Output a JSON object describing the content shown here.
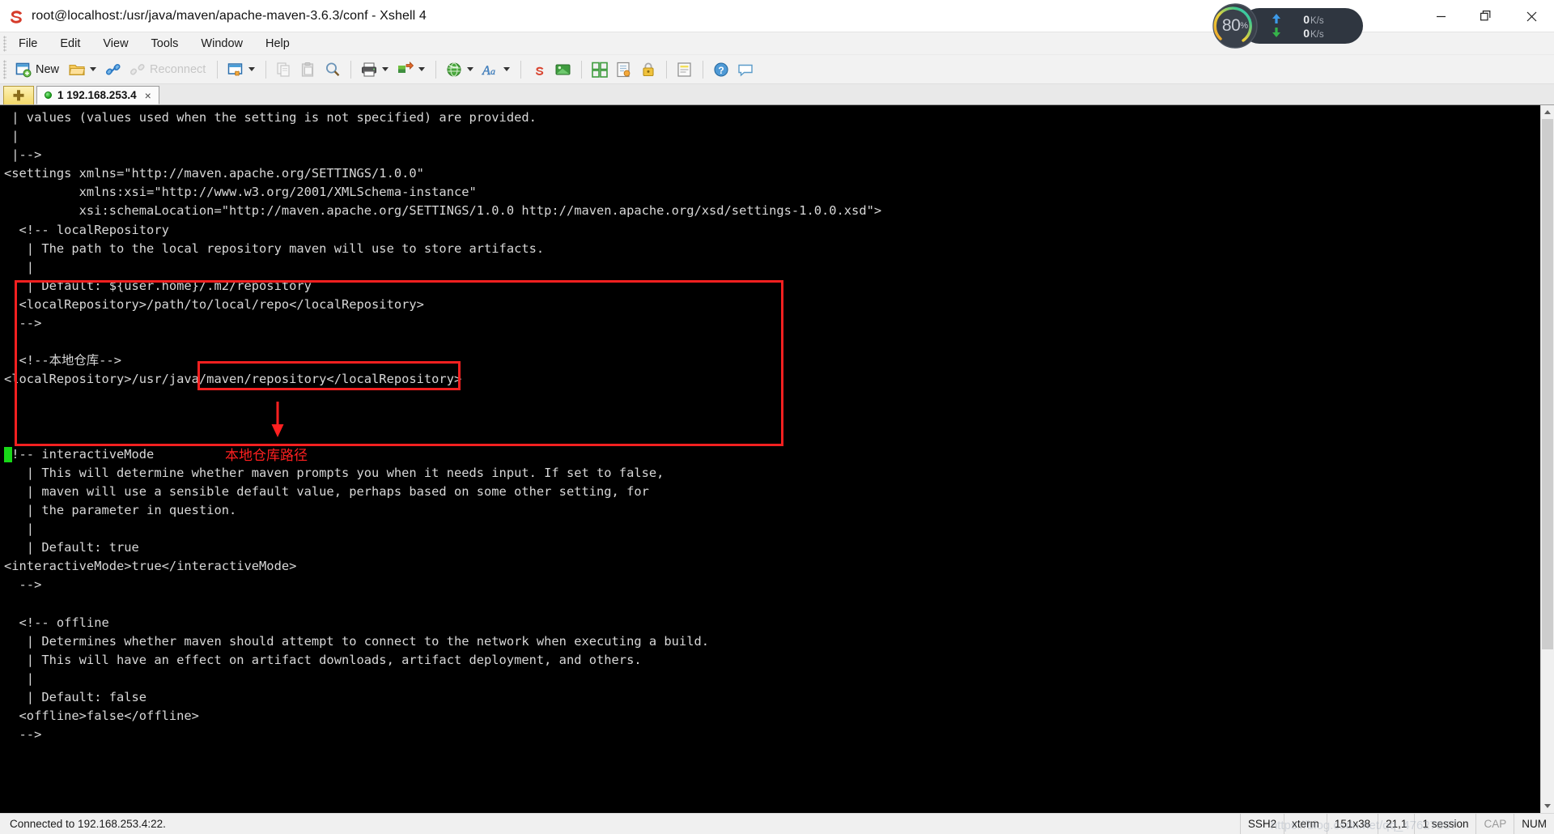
{
  "window": {
    "title": "root@localhost:/usr/java/maven/apache-maven-3.6.3/conf - Xshell 4",
    "app_icon": "xshell-icon",
    "minimize_label": "—",
    "maximize_label": "❐",
    "close_label": "✕"
  },
  "menu": {
    "items": [
      {
        "label": "File"
      },
      {
        "label": "Edit"
      },
      {
        "label": "View"
      },
      {
        "label": "Tools"
      },
      {
        "label": "Window"
      },
      {
        "label": "Help"
      }
    ]
  },
  "toolbar": {
    "new_label": "New",
    "new_icon": "new-session-icon",
    "open_icon": "open-folder-icon",
    "connect_icon": "connect-icon",
    "reconnect_label": "Reconnect",
    "reconnect_icon": "reconnect-icon",
    "properties_icon": "session-properties-icon",
    "copy_icon": "copy-icon",
    "paste_icon": "paste-icon",
    "find_icon": "find-icon",
    "print_icon": "print-icon",
    "transfer_icon": "file-transfer-icon",
    "web_icon": "web-browser-icon",
    "font_icon": "font-icon",
    "ztransfer_icon": "zmodem-transfer-icon",
    "xftp_icon": "xftp-icon",
    "compose_icon": "compose-bar-icon",
    "log_icon": "log-icon",
    "lock_icon": "lock-icon",
    "highlight_icon": "highlight-icon",
    "help_icon": "help-icon",
    "chat_icon": "chat-icon"
  },
  "tabs": {
    "new_tab_icon": "plus-icon",
    "new_tab_glyph": "✚",
    "items": [
      {
        "title": "1 192.168.253.4",
        "status_dot": "connected-dot",
        "close_glyph": "×"
      }
    ]
  },
  "terminal": {
    "cursor": {
      "line_index": 18,
      "color": "#18d818"
    },
    "lines": [
      " | values (values used when the setting is not specified) are provided.",
      " |",
      " |-->",
      "<settings xmlns=\"http://maven.apache.org/SETTINGS/1.0.0\"",
      "          xmlns:xsi=\"http://www.w3.org/2001/XMLSchema-instance\"",
      "          xsi:schemaLocation=\"http://maven.apache.org/SETTINGS/1.0.0 http://maven.apache.org/xsd/settings-1.0.0.xsd\">",
      "  <!-- localRepository",
      "   | The path to the local repository maven will use to store artifacts.",
      "   |",
      "   | Default: ${user.home}/.m2/repository",
      "  <localRepository>/path/to/local/repo</localRepository>",
      "  -->",
      "",
      "  <!--本地仓库-->",
      "<localRepository>/usr/java/maven/repository</localRepository>",
      "",
      "",
      "",
      "<!-- interactiveMode",
      "   | This will determine whether maven prompts you when it needs input. If set to false,",
      "   | maven will use a sensible default value, perhaps based on some other setting, for",
      "   | the parameter in question.",
      "   |",
      "   | Default: true",
      "<interactiveMode>true</interactiveMode>",
      "  -->",
      "",
      "  <!-- offline",
      "   | Determines whether maven should attempt to connect to the network when executing a build.",
      "   | This will have an effect on artifact downloads, artifact deployment, and others.",
      "   |",
      "   | Default: false",
      "  <offline>false</offline>",
      "  -->"
    ]
  },
  "annotations": {
    "outer_box_label": "local-repository-highlight-box",
    "value_box_label": "repository-path-highlight-box",
    "callout_text": "本地仓库路径",
    "arrow_label": "red-down-arrow",
    "color": "#f42020"
  },
  "netspeed": {
    "percent": "80",
    "percent_unit": "%",
    "upload_value": "0",
    "upload_unit": "K/s",
    "upload_icon": "arrow-up-icon",
    "upload_glyph": "⬆",
    "download_value": "0",
    "download_unit": "K/s",
    "download_icon": "arrow-down-icon",
    "download_glyph": "⬇"
  },
  "statusbar": {
    "connection": "Connected to 192.168.253.4:22.",
    "protocol": "SSH2",
    "terminal_type": "xterm",
    "size": "151x38",
    "cursor_pos": "21,1",
    "sessions": "1 session",
    "cap": "CAP",
    "num": "NUM",
    "watermark": "https://blog.csdn.net/qq_47627857"
  }
}
